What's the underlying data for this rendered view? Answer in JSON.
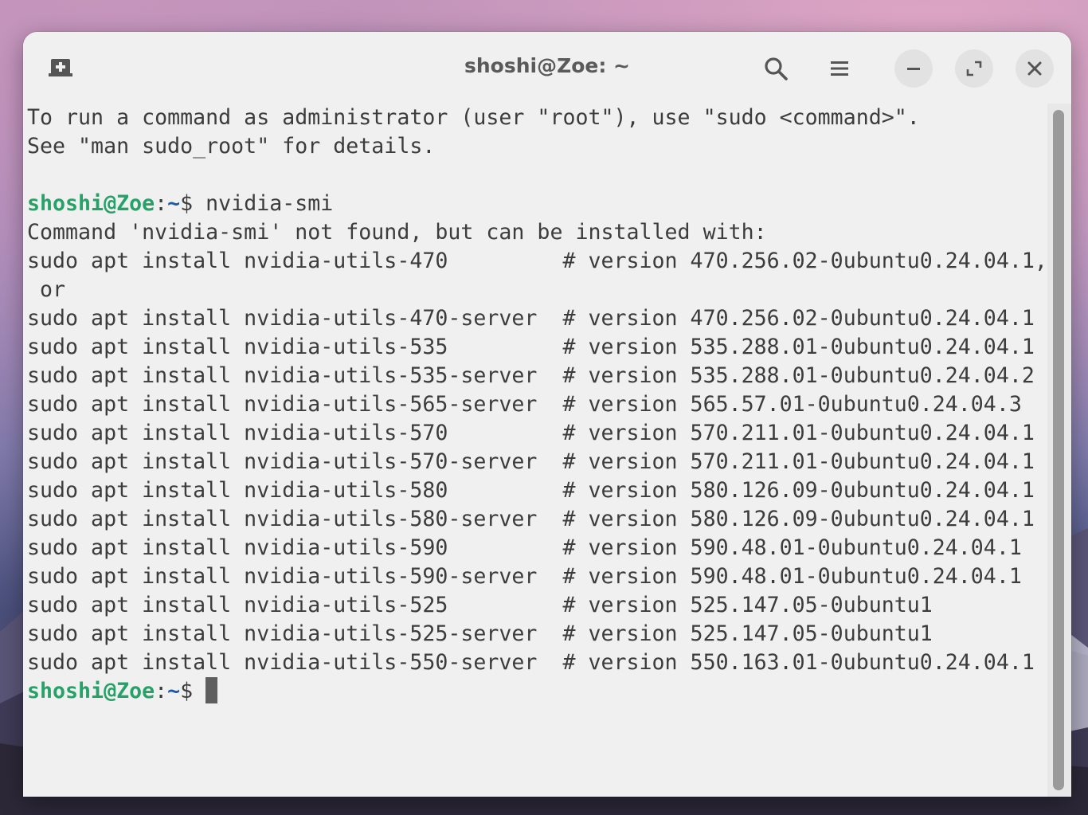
{
  "window": {
    "title": "shoshi@Zoe: ~",
    "icons": {
      "new_tab": "new-tab-icon",
      "search": "search-icon",
      "menu": "hamburger-menu-icon",
      "minimize": "minimize-icon",
      "maximize": "maximize-icon",
      "close": "close-icon"
    }
  },
  "prompt": {
    "user_host": "shoshi@Zoe",
    "colon": ":",
    "path": "~",
    "symbol": "$ "
  },
  "terminal": {
    "intro_lines": [
      "To run a command as administrator (user \"root\"), use \"sudo <command>\".",
      "See \"man sudo_root\" for details.",
      ""
    ],
    "command": "nvidia-smi",
    "output_lines": [
      "Command 'nvidia-smi' not found, but can be installed with:",
      "sudo apt install nvidia-utils-470         # version 470.256.02-0ubuntu0.24.04.1,",
      " or",
      "sudo apt install nvidia-utils-470-server  # version 470.256.02-0ubuntu0.24.04.1",
      "sudo apt install nvidia-utils-535         # version 535.288.01-0ubuntu0.24.04.1",
      "sudo apt install nvidia-utils-535-server  # version 535.288.01-0ubuntu0.24.04.2",
      "sudo apt install nvidia-utils-565-server  # version 565.57.01-0ubuntu0.24.04.3",
      "sudo apt install nvidia-utils-570         # version 570.211.01-0ubuntu0.24.04.1",
      "sudo apt install nvidia-utils-570-server  # version 570.211.01-0ubuntu0.24.04.1",
      "sudo apt install nvidia-utils-580         # version 580.126.09-0ubuntu0.24.04.1",
      "sudo apt install nvidia-utils-580-server  # version 580.126.09-0ubuntu0.24.04.1",
      "sudo apt install nvidia-utils-590         # version 590.48.01-0ubuntu0.24.04.1",
      "sudo apt install nvidia-utils-590-server  # version 590.48.01-0ubuntu0.24.04.1",
      "sudo apt install nvidia-utils-525         # version 525.147.05-0ubuntu1",
      "sudo apt install nvidia-utils-525-server  # version 525.147.05-0ubuntu1",
      "sudo apt install nvidia-utils-550-server  # version 550.163.01-0ubuntu0.24.04.1"
    ]
  },
  "colors": {
    "prompt_user": "#26a269",
    "prompt_path": "#1c5aa6",
    "text": "#3c3c3c",
    "background": "#f0f0f0"
  }
}
